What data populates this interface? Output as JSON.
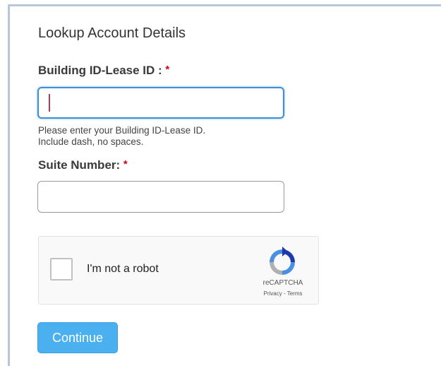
{
  "form": {
    "title": "Lookup Account Details",
    "building_field": {
      "label": "Building ID-Lease ID :",
      "required_mark": "*",
      "value": "",
      "help_line1": "Please enter your Building ID-Lease ID.",
      "help_line2": "Include dash, no spaces."
    },
    "suite_field": {
      "label": "Suite Number:",
      "required_mark": "*",
      "value": ""
    },
    "recaptcha": {
      "checkbox_label": "I'm not a robot",
      "brand": "reCAPTCHA",
      "links": "Privacy - Terms",
      "icon": "recaptcha-logo-icon"
    },
    "continue_label": "Continue"
  },
  "colors": {
    "accent": "#4ab0ef",
    "focus_border": "#3d8fd6",
    "required": "#d0021b",
    "panel_border": "#b8c7dc"
  }
}
